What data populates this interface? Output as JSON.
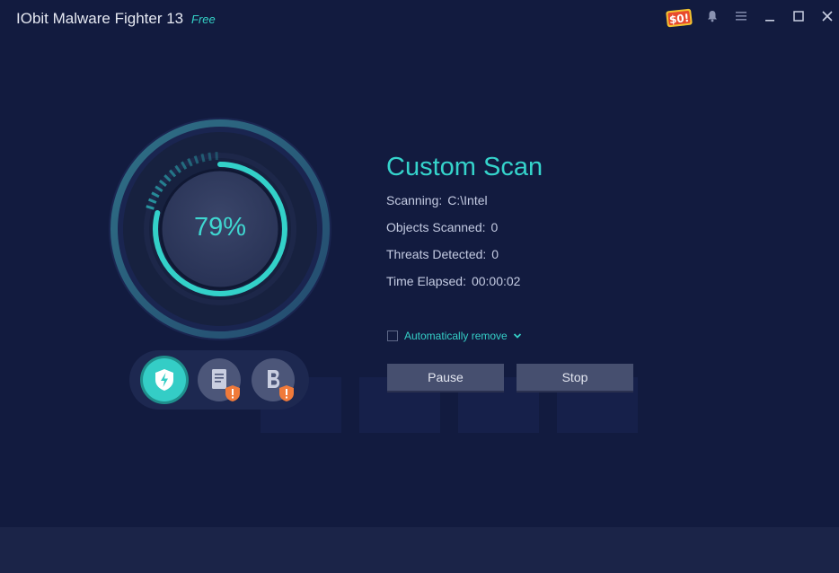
{
  "app": {
    "name": "IObit Malware Fighter 13",
    "edition": "Free"
  },
  "window_controls": {
    "promo_text": "$0!",
    "icons": [
      "notification-bell-icon",
      "menu-icon",
      "minimize-icon",
      "maximize-icon",
      "close-icon"
    ]
  },
  "progress": {
    "percent_label": "79%",
    "fraction": 0.79
  },
  "scan": {
    "title": "Custom Scan",
    "scanning_label": "Scanning:",
    "scanning_value": "C:\\Intel",
    "objects_label": "Objects Scanned:",
    "objects_value": "0",
    "threats_label": "Threats Detected:",
    "threats_value": "0",
    "time_label": "Time Elapsed:",
    "time_value": "00:00:02"
  },
  "options": {
    "auto_remove_label": "Automatically remove",
    "auto_remove_checked": false
  },
  "buttons": {
    "pause": "Pause",
    "stop": "Stop"
  },
  "modules": [
    {
      "icon": "shield-bolt-icon",
      "status": "active"
    },
    {
      "icon": "document-icon",
      "status": "warning"
    },
    {
      "icon": "browser-b-icon",
      "status": "warning"
    }
  ],
  "colors": {
    "accent": "#35d3cb",
    "background": "#121b3f",
    "warning": "#f07a3a",
    "button": "#464f6f"
  }
}
